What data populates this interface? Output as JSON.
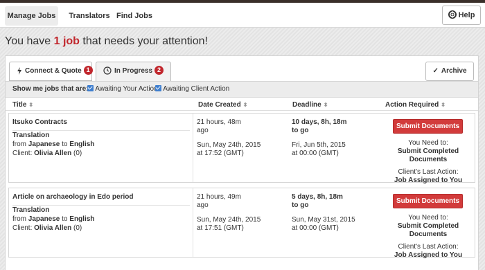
{
  "nav": {
    "items": [
      {
        "label": "Manage Jobs",
        "active": true
      },
      {
        "label": "Translators",
        "active": false
      },
      {
        "label": "Find Jobs",
        "active": false
      }
    ],
    "help_label": "Help"
  },
  "headline": {
    "prefix": "You have ",
    "highlight": "1 job",
    "suffix": " that needs your attention!"
  },
  "tabs": [
    {
      "label": "Connect & Quote",
      "badge": "1",
      "active": false
    },
    {
      "label": "In Progress",
      "badge": "2",
      "active": true
    }
  ],
  "archive_label": "Archive",
  "filters": {
    "label": "Show me jobs that are:",
    "options": [
      {
        "label": "Awaiting Your Action",
        "checked": true
      },
      {
        "label": "Awaiting Client Action",
        "checked": true
      }
    ]
  },
  "columns": [
    "Title",
    "Date Created",
    "Deadline",
    "Action Required"
  ],
  "jobs": [
    {
      "title": "Itsuko Contracts",
      "type": "Translation",
      "from_prefix": "from ",
      "from_lang": "Japanese",
      "to_word": " to ",
      "to_lang": "English",
      "client_prefix": "Client: ",
      "client": "Olivia Allen",
      "client_count": " (0)",
      "created_rel_1": "21 hours, 48m",
      "created_rel_2": "ago",
      "created_date": "Sun, May 24th, 2015",
      "created_time": "at 17:52 (GMT)",
      "deadline_rel_1": "10 days, 8h, 18m",
      "deadline_rel_2": "to go",
      "deadline_date": "Fri, Jun 5th, 2015",
      "deadline_time": "at 00:00 (GMT)",
      "action_button": "Submit Documents",
      "need_label": "You Need to:",
      "need_1": "Submit Completed",
      "need_2": "Documents",
      "last_label": "Client's Last Action:",
      "last_value": "Job Assigned to You"
    },
    {
      "title": "Article on archaeology in Edo period",
      "type": "Translation",
      "from_prefix": "from ",
      "from_lang": "Japanese",
      "to_word": " to ",
      "to_lang": "English",
      "client_prefix": "Client: ",
      "client": "Olivia Allen",
      "client_count": " (0)",
      "created_rel_1": "21 hours, 49m",
      "created_rel_2": "ago",
      "created_date": "Sun, May 24th, 2015",
      "created_time": "at 17:51 (GMT)",
      "deadline_rel_1": "5 days, 8h, 18m",
      "deadline_rel_2": "to go",
      "deadline_date": "Sun, May 31st, 2015",
      "deadline_time": "at 00:00 (GMT)",
      "action_button": "Submit Documents",
      "need_label": "You Need to:",
      "need_1": "Submit Completed",
      "need_2": "Documents",
      "last_label": "Client's Last Action:",
      "last_value": "Job Assigned to You"
    }
  ],
  "colors": {
    "accent": "#c1272d",
    "button": "#d23b3b",
    "checkbox": "#3f7fcf"
  },
  "icons": {
    "help": "lifebuoy-icon",
    "connect": "lightning-icon",
    "progress": "clock-icon",
    "archive": "checkmark-icon",
    "sort": "sort-icon"
  }
}
